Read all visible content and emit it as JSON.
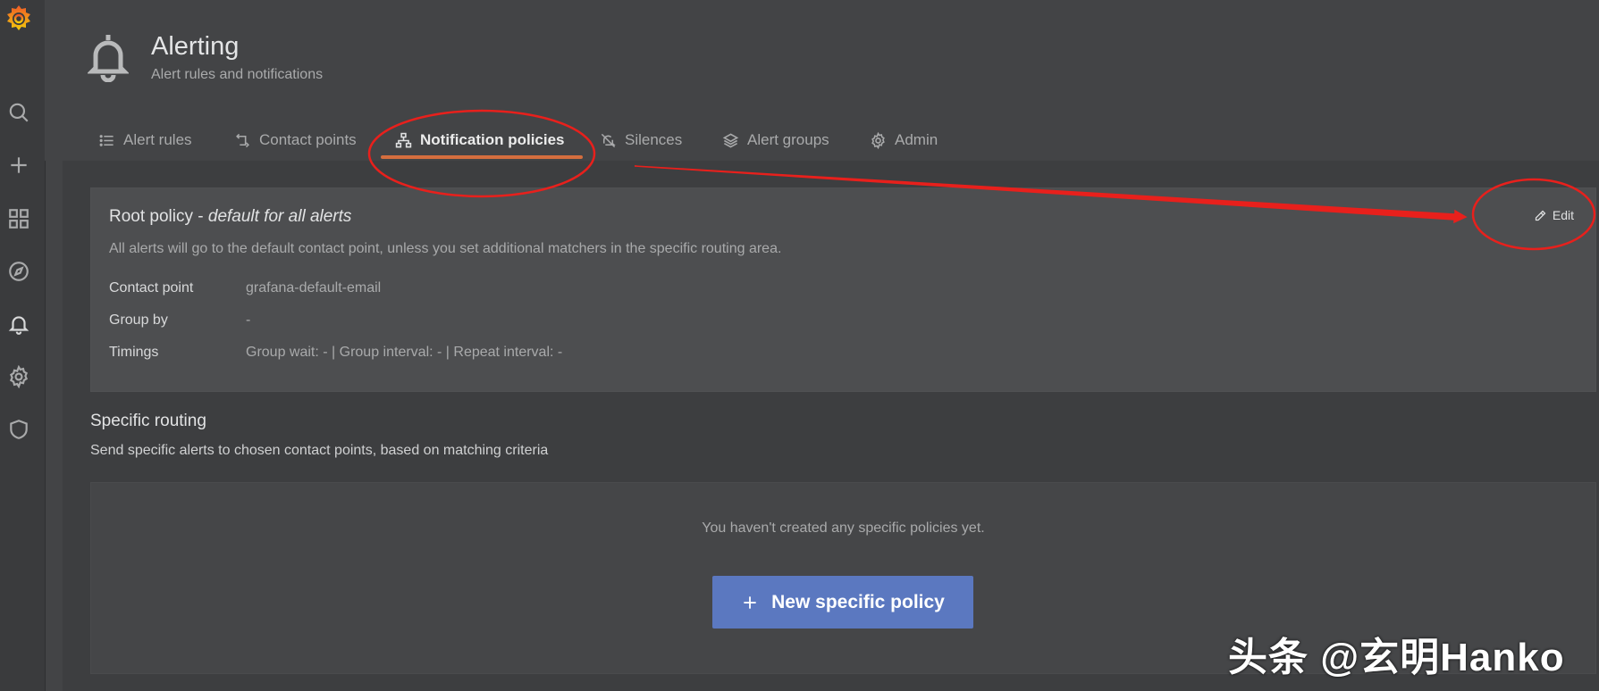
{
  "header": {
    "title": "Alerting",
    "subtitle": "Alert rules and notifications"
  },
  "tabs": [
    {
      "label": "Alert rules",
      "icon": "list-icon"
    },
    {
      "label": "Contact points",
      "icon": "contact-point-icon"
    },
    {
      "label": "Notification policies",
      "icon": "sitemap-icon",
      "active": true
    },
    {
      "label": "Silences",
      "icon": "bell-slash-icon"
    },
    {
      "label": "Alert groups",
      "icon": "layers-icon"
    },
    {
      "label": "Admin",
      "icon": "gear-icon"
    }
  ],
  "sidebar": {
    "items": [
      "search-icon",
      "plus-icon",
      "dashboards-icon",
      "explore-icon",
      "alerting-bell-icon",
      "configuration-gear-icon",
      "shield-icon"
    ]
  },
  "root_policy": {
    "title": "Root policy",
    "title_suffix": "default for all alerts",
    "description": "All alerts will go to the default contact point, unless you set additional matchers in the specific routing area.",
    "edit_label": "Edit",
    "rows": [
      {
        "label": "Contact point",
        "value": "grafana-default-email"
      },
      {
        "label": "Group by",
        "value": "-"
      },
      {
        "label": "Timings",
        "value": "Group wait: - | Group interval: - | Repeat interval: -"
      }
    ]
  },
  "specific_routing": {
    "title": "Specific routing",
    "subtitle": "Send specific alerts to chosen contact points, based on matching criteria",
    "empty_text": "You haven't created any specific policies yet.",
    "new_button_label": "New specific policy"
  },
  "watermark": "头条 @玄明Hanko",
  "colors": {
    "accent": "#d56e3e",
    "primary_button": "#5b78c0",
    "annotation": "#e8201c"
  }
}
